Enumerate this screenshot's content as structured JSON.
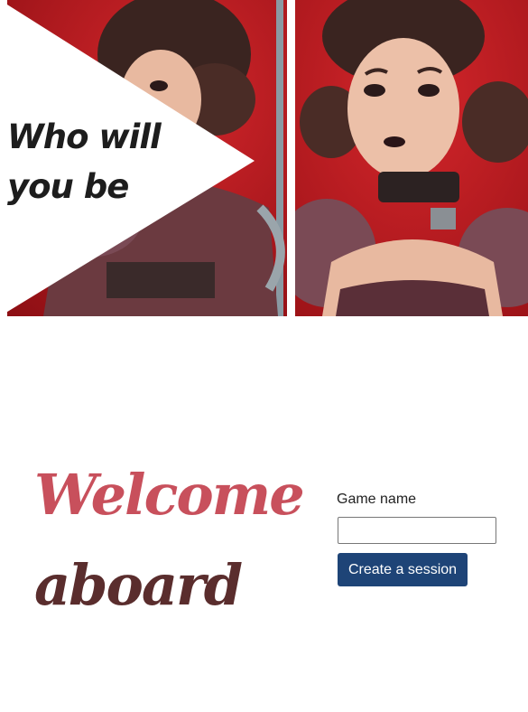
{
  "hero": {
    "tagline_line1": "Who will",
    "tagline_line2": "you be",
    "character_image": "character-portrait",
    "colors": {
      "background_red": "#b5161b",
      "hair": "#3a2420",
      "skin": "#e8b9a0",
      "outfit": "#6b3a40"
    }
  },
  "welcome": {
    "line1": "Welcome",
    "line2": "aboard",
    "colors": {
      "line1": "#c8505c",
      "line2": "#5a2d2d"
    }
  },
  "form": {
    "game_name_label": "Game name",
    "game_name_value": "",
    "game_name_placeholder": "",
    "create_button_label": "Create a session",
    "button_color": "#1e4477"
  }
}
